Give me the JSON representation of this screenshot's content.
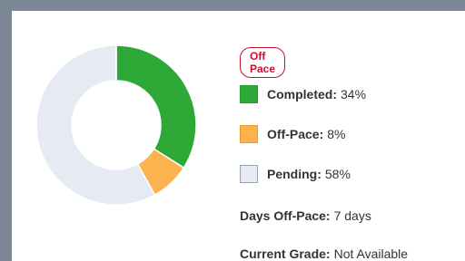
{
  "status_badge": "Off Pace",
  "colors": {
    "completed": "#2ea836",
    "off_pace": "#fbb24f",
    "pending": "#e6eaf2",
    "badge": "#c8102e"
  },
  "legend": [
    {
      "label": "Completed:",
      "value": "34%",
      "color": "#2ea836",
      "border": "#239a2b"
    },
    {
      "label": "Off-Pace:",
      "value": "8%",
      "color": "#fbb24f",
      "border": "#e89a2f"
    },
    {
      "label": "Pending:",
      "value": "58%",
      "color": "#e6eaf2",
      "border": "#9aa3b0"
    }
  ],
  "days_off_pace": {
    "label": "Days Off-Pace:",
    "value": "7 days"
  },
  "current_grade": {
    "label": "Current Grade:",
    "value": "Not Available"
  },
  "chart_data": {
    "type": "pie",
    "donut": true,
    "categories": [
      "Completed",
      "Off-Pace",
      "Pending"
    ],
    "values": [
      34,
      8,
      58
    ],
    "colors": [
      "#2ea836",
      "#fbb24f",
      "#e6eaf2"
    ]
  }
}
